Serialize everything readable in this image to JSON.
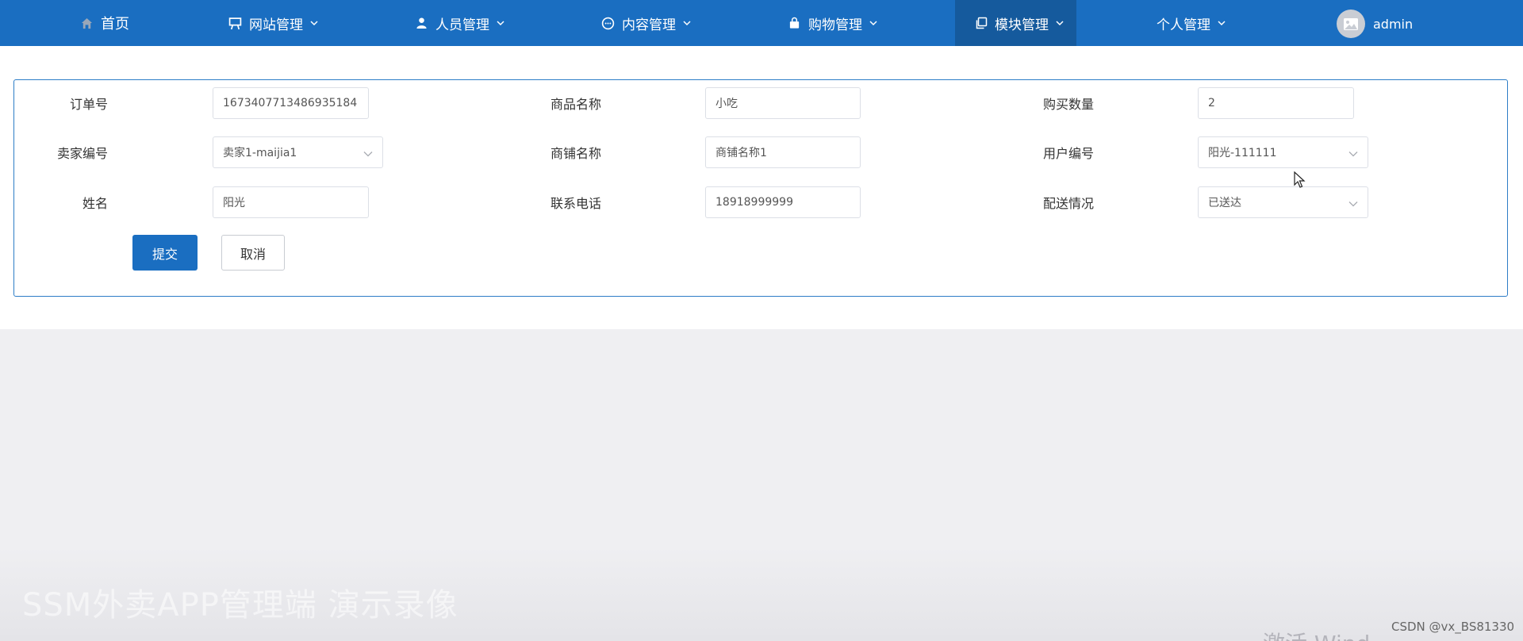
{
  "nav": {
    "home": "首页",
    "items": [
      {
        "label": "网站管理",
        "icon": "easel-icon"
      },
      {
        "label": "人员管理",
        "icon": "person-icon"
      },
      {
        "label": "内容管理",
        "icon": "chat-icon"
      },
      {
        "label": "购物管理",
        "icon": "bag-icon"
      },
      {
        "label": "模块管理",
        "icon": "copy-icon",
        "active": true
      },
      {
        "label": "个人管理",
        "icon": ""
      }
    ],
    "user": "admin"
  },
  "form": {
    "order_no": {
      "label": "订单号",
      "value": "1673407713486935184"
    },
    "product_name": {
      "label": "商品名称",
      "value": "小吃"
    },
    "quantity": {
      "label": "购买数量",
      "value": "2"
    },
    "seller_no": {
      "label": "卖家编号",
      "value": "卖家1-maijia1"
    },
    "shop_name": {
      "label": "商铺名称",
      "value": "商铺名称1"
    },
    "user_no": {
      "label": "用户编号",
      "value": "阳光-111111"
    },
    "name": {
      "label": "姓名",
      "value": "阳光"
    },
    "phone": {
      "label": "联系电话",
      "value": "18918999999"
    },
    "delivery": {
      "label": "配送情况",
      "value": "已送达"
    },
    "submit": "提交",
    "cancel": "取消"
  },
  "overlay": {
    "watermark": "SSM外卖APP管理端 演示录像",
    "activate": "激活 Wind",
    "csdn": "CSDN @vx_BS81330"
  },
  "colors": {
    "primary": "#1a6ec1",
    "active_nav": "#155a9d"
  }
}
